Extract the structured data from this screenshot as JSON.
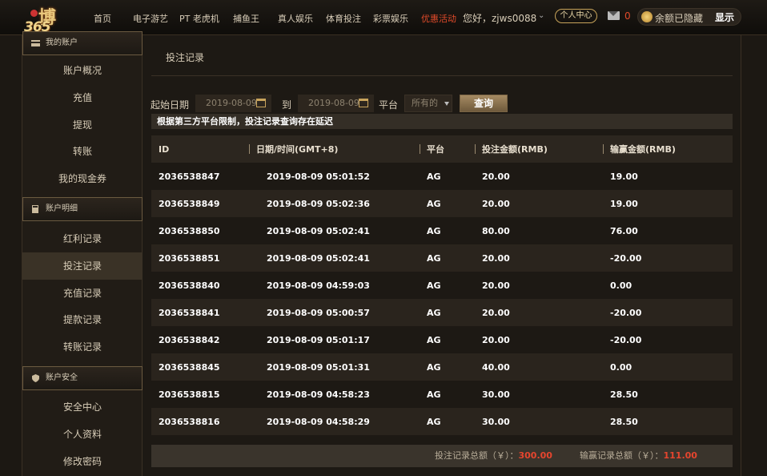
{
  "logo": {
    "char": "博",
    "num": "365"
  },
  "nav": {
    "items": [
      "首页",
      "电子游艺",
      "PT 老虎机",
      "捕鱼王",
      "真人娱乐",
      "体育投注",
      "彩票娱乐"
    ],
    "promo": "优惠活动",
    "greeting": "您好，zjws0088",
    "personal_center": "个人中心",
    "mail_count": "0",
    "balance_hidden": "余额已隐藏",
    "show": "显示"
  },
  "sidebar": {
    "section1": "我的账户",
    "account_items": [
      "账户概况",
      "充值",
      "提现",
      "转账",
      "我的现金券"
    ],
    "section2": "账户明细",
    "detail_items": [
      "红利记录",
      "投注记录",
      "充值记录",
      "提款记录",
      "转账记录"
    ],
    "section3": "账户安全",
    "security_items": [
      "安全中心",
      "个人资料",
      "修改密码"
    ]
  },
  "page": {
    "title": "投注记录",
    "start_label": "起始日期",
    "start_date": "2019-08-09",
    "to_label": "到",
    "end_date": "2019-08-09",
    "platform_label": "平台",
    "platform_value": "所有的",
    "query_button": "查询",
    "notice": "根据第三方平台限制，投注记录查询存在延迟"
  },
  "table": {
    "headers": [
      "ID",
      "日期/时间(GMT+8)",
      "平台",
      "投注金额(RMB)",
      "输赢金额(RMB)"
    ],
    "rows": [
      [
        "2036538847",
        "2019-08-09 05:01:52",
        "AG",
        "20.00",
        "19.00"
      ],
      [
        "2036538849",
        "2019-08-09 05:02:36",
        "AG",
        "20.00",
        "19.00"
      ],
      [
        "2036538850",
        "2019-08-09 05:02:41",
        "AG",
        "80.00",
        "76.00"
      ],
      [
        "2036538851",
        "2019-08-09 05:02:41",
        "AG",
        "20.00",
        "-20.00"
      ],
      [
        "2036538840",
        "2019-08-09 04:59:03",
        "AG",
        "20.00",
        "0.00"
      ],
      [
        "2036538841",
        "2019-08-09 05:00:57",
        "AG",
        "20.00",
        "-20.00"
      ],
      [
        "2036538842",
        "2019-08-09 05:01:17",
        "AG",
        "20.00",
        "-20.00"
      ],
      [
        "2036538845",
        "2019-08-09 05:01:31",
        "AG",
        "40.00",
        "0.00"
      ],
      [
        "2036538815",
        "2019-08-09 04:58:23",
        "AG",
        "30.00",
        "28.50"
      ],
      [
        "2036538816",
        "2019-08-09 04:58:29",
        "AG",
        "30.00",
        "28.50"
      ]
    ]
  },
  "footer": {
    "bet_label": "投注记录总额（￥）：",
    "bet_total": "300.00",
    "win_label": "输赢记录总额（￥）：",
    "win_total": "111.00"
  },
  "colors": {
    "accent_red": "#e5452e",
    "gold": "#c8a45a"
  }
}
